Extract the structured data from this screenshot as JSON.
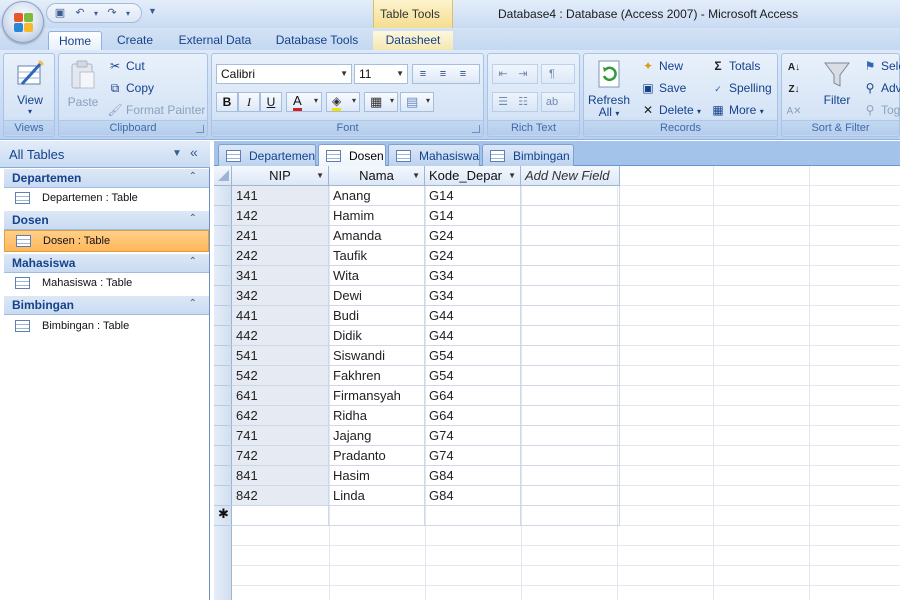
{
  "window": {
    "title": "Database4 : Database (Access 2007) - Microsoft Access",
    "context_tool": "Table Tools"
  },
  "ribbon_tabs": [
    "Home",
    "Create",
    "External Data",
    "Database Tools",
    "Datasheet"
  ],
  "ribbon": {
    "views": {
      "label": "Views",
      "view": "View"
    },
    "clipboard": {
      "label": "Clipboard",
      "paste": "Paste",
      "cut": "Cut",
      "copy": "Copy",
      "format_painter": "Format Painter"
    },
    "font": {
      "label": "Font",
      "family": "Calibri",
      "size": "11",
      "bold": "B",
      "italic": "I",
      "underline": "U",
      "font_color": "A"
    },
    "rich_text": {
      "label": "Rich Text"
    },
    "records": {
      "label": "Records",
      "refresh": "Refresh",
      "refresh_all": "All",
      "new": "New",
      "save": "Save",
      "delete": "Delete",
      "totals": "Totals",
      "spelling": "Spelling",
      "more": "More"
    },
    "sort_filter": {
      "label": "Sort & Filter",
      "filter": "Filter",
      "selection": "Sele",
      "advanced": "Adv",
      "toggle": "Tog"
    }
  },
  "nav_pane": {
    "title": "All Tables",
    "groups": [
      {
        "name": "Departemen",
        "item": "Departemen : Table"
      },
      {
        "name": "Dosen",
        "item": "Dosen : Table"
      },
      {
        "name": "Mahasiswa",
        "item": "Mahasiswa : Table"
      },
      {
        "name": "Bimbingan",
        "item": "Bimbingan : Table"
      }
    ]
  },
  "doc_tabs": [
    "Departemen",
    "Dosen",
    "Mahasiswa",
    "Bimbingan"
  ],
  "datasheet": {
    "columns": [
      "NIP",
      "Nama",
      "Kode_Depar",
      "Add New Field"
    ],
    "rows": [
      [
        "141",
        "Anang",
        "G14"
      ],
      [
        "142",
        "Hamim",
        "G14"
      ],
      [
        "241",
        "Amanda",
        "G24"
      ],
      [
        "242",
        "Taufik",
        "G24"
      ],
      [
        "341",
        "Wita",
        "G34"
      ],
      [
        "342",
        "Dewi",
        "G34"
      ],
      [
        "441",
        "Budi",
        "G44"
      ],
      [
        "442",
        "Didik",
        "G44"
      ],
      [
        "541",
        "Siswandi",
        "G54"
      ],
      [
        "542",
        "Fakhren",
        "G54"
      ],
      [
        "641",
        "Firmansyah",
        "G64"
      ],
      [
        "642",
        "Ridha",
        "G64"
      ],
      [
        "741",
        "Jajang",
        "G74"
      ],
      [
        "742",
        "Pradanto",
        "G74"
      ],
      [
        "841",
        "Hasim",
        "G84"
      ],
      [
        "842",
        "Linda",
        "G84"
      ]
    ],
    "new_record_marker": "✱"
  },
  "colors": {
    "accent": "#15428b",
    "selection": "#ffb659",
    "ribbon": "#c7daf2"
  }
}
